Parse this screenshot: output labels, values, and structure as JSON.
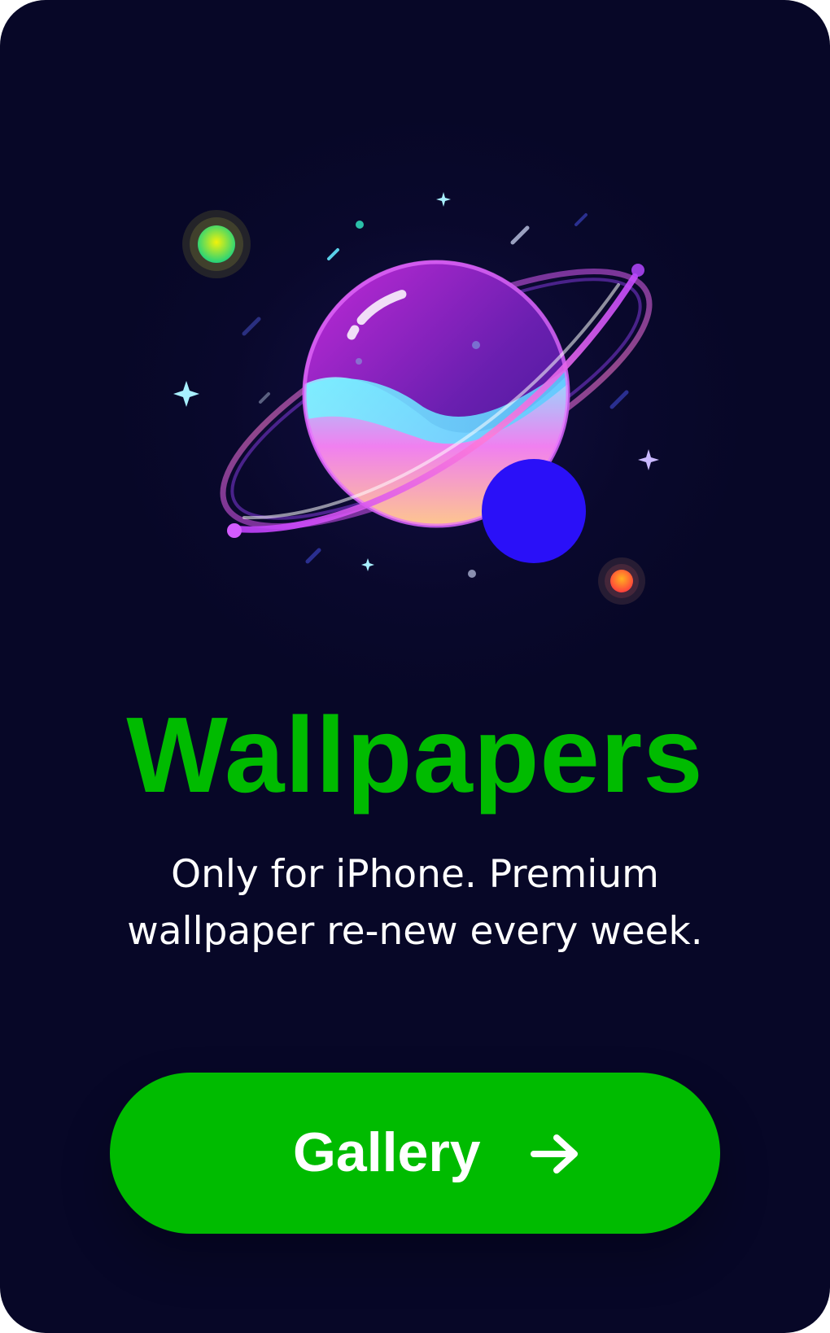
{
  "hero": {
    "title": "Wallpapers",
    "subtitle_line1": "Only for iPhone. Premium",
    "subtitle_line2": "wallpaper re-new every week."
  },
  "cta": {
    "label": "Gallery",
    "icon": "arrow-right-icon"
  },
  "illustration": {
    "icon": "planet-icon"
  },
  "colors": {
    "background": "#070727",
    "accent_green": "#00bb00",
    "text": "#ffffff"
  }
}
